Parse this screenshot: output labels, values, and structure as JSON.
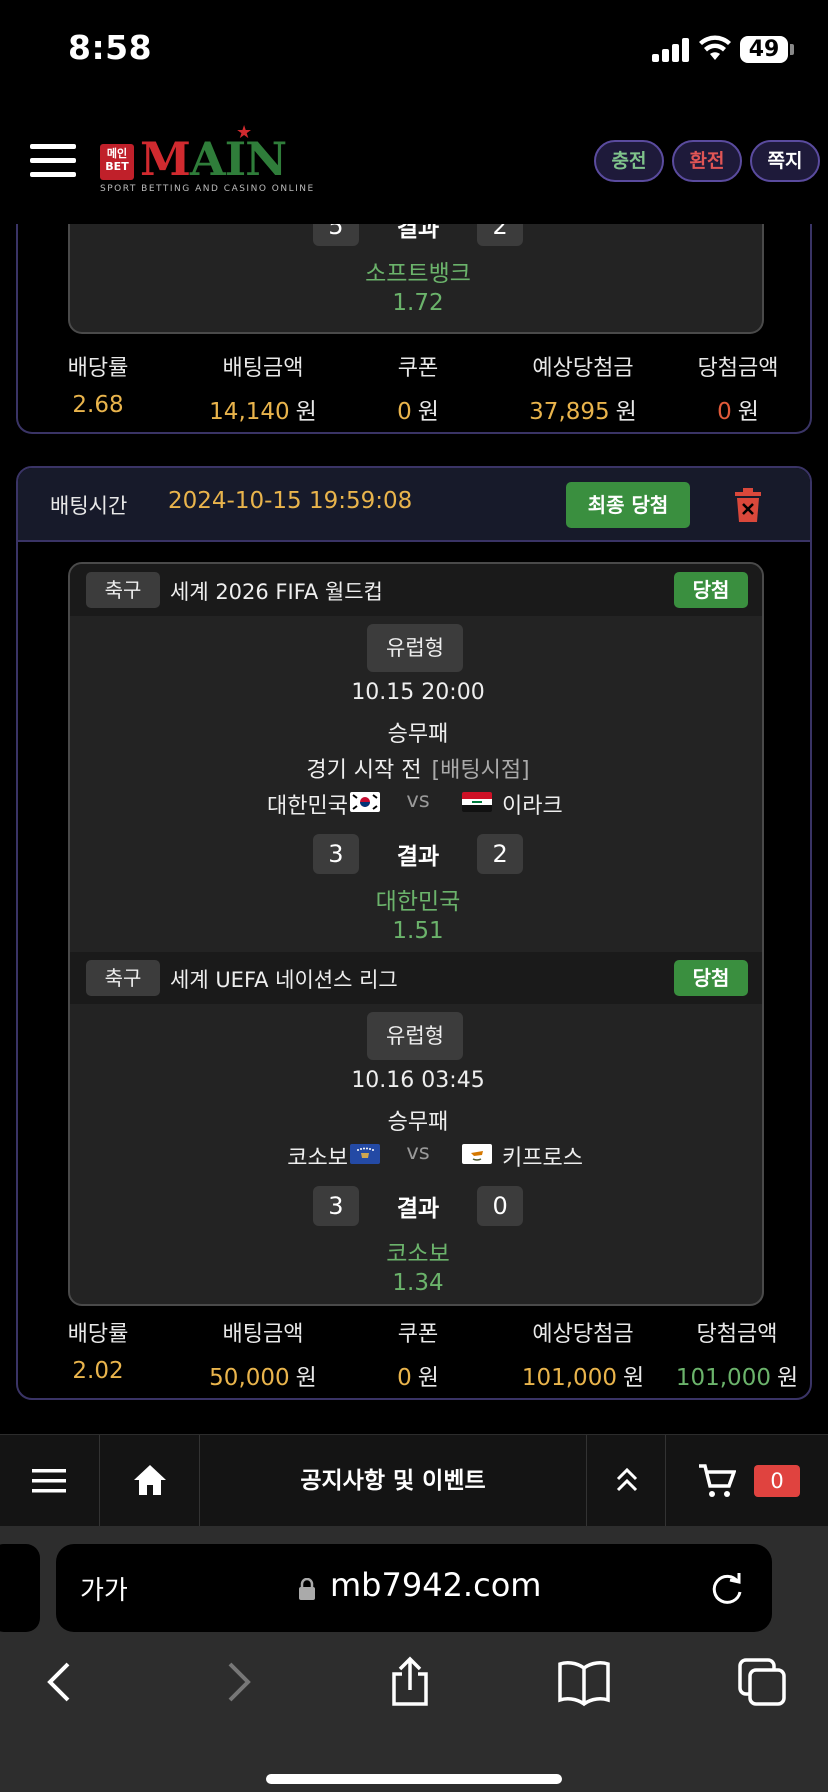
{
  "status": {
    "time": "8:58",
    "battery": "49"
  },
  "header": {
    "logo_badge": "메인BET",
    "logo_text_m": "M",
    "logo_text_ain": "AIN",
    "logo_sub": "SPORT BETTING AND CASINO ONLINE",
    "buttons": {
      "charge": "충전",
      "exchange": "환전",
      "message": "쪽지"
    }
  },
  "bet1": {
    "score_home": "5",
    "result_label": "결과",
    "score_away": "2",
    "winner": "소프트뱅크",
    "odds": "1.72",
    "summary": {
      "odds_label": "배당률",
      "odds_value": "2.68",
      "amount_label": "배팅금액",
      "amount_value": "14,140",
      "coupon_label": "쿠폰",
      "coupon_value": "0",
      "expected_label": "예상당첨금",
      "expected_value": "37,895",
      "win_label": "당첨금액",
      "win_value": "0",
      "unit": "원"
    }
  },
  "bet2": {
    "time_label": "배팅시간",
    "time_value": "2024-10-15 19:59:08",
    "final_button": "최종 당첨",
    "matches": [
      {
        "sport": "축구",
        "league": "세계 2026 FIFA 월드컵",
        "status": "당첨",
        "type": "유럽형",
        "datetime": "10.15 20:00",
        "market": "승무패",
        "phase": "경기 시작 전",
        "phase_note": "[배팅시점]",
        "home": "대한민국",
        "vs": "vs",
        "away": "이라크",
        "score_home": "3",
        "result_label": "결과",
        "score_away": "2",
        "winner": "대한민국",
        "odds": "1.51"
      },
      {
        "sport": "축구",
        "league": "세계 UEFA 네이션스 리그",
        "status": "당첨",
        "type": "유럽형",
        "datetime": "10.16 03:45",
        "market": "승무패",
        "home": "코소보",
        "vs": "vs",
        "away": "키프로스",
        "score_home": "3",
        "result_label": "결과",
        "score_away": "0",
        "winner": "코소보",
        "odds": "1.34"
      }
    ],
    "summary": {
      "odds_label": "배당률",
      "odds_value": "2.02",
      "amount_label": "배팅금액",
      "amount_value": "50,000",
      "coupon_label": "쿠폰",
      "coupon_value": "0",
      "expected_label": "예상당첨금",
      "expected_value": "101,000",
      "win_label": "당첨금액",
      "win_value": "101,000",
      "unit": "원"
    }
  },
  "bottom_nav": {
    "title": "공지사항 및 이벤트",
    "cart_count": "0"
  },
  "browser": {
    "aa": "가가",
    "url": "mb7942.com"
  },
  "colors": {
    "gold": "#e9b44c",
    "green": "#6bb36b",
    "red": "#e05a3a",
    "accent_border": "#3a3466"
  },
  "icons": [
    "menu-icon",
    "home-icon",
    "chevron-double-up-icon",
    "cart-icon",
    "trash-icon",
    "lock-icon",
    "reload-icon",
    "back-icon",
    "forward-icon",
    "share-icon",
    "bookmarks-icon",
    "tabs-icon"
  ]
}
